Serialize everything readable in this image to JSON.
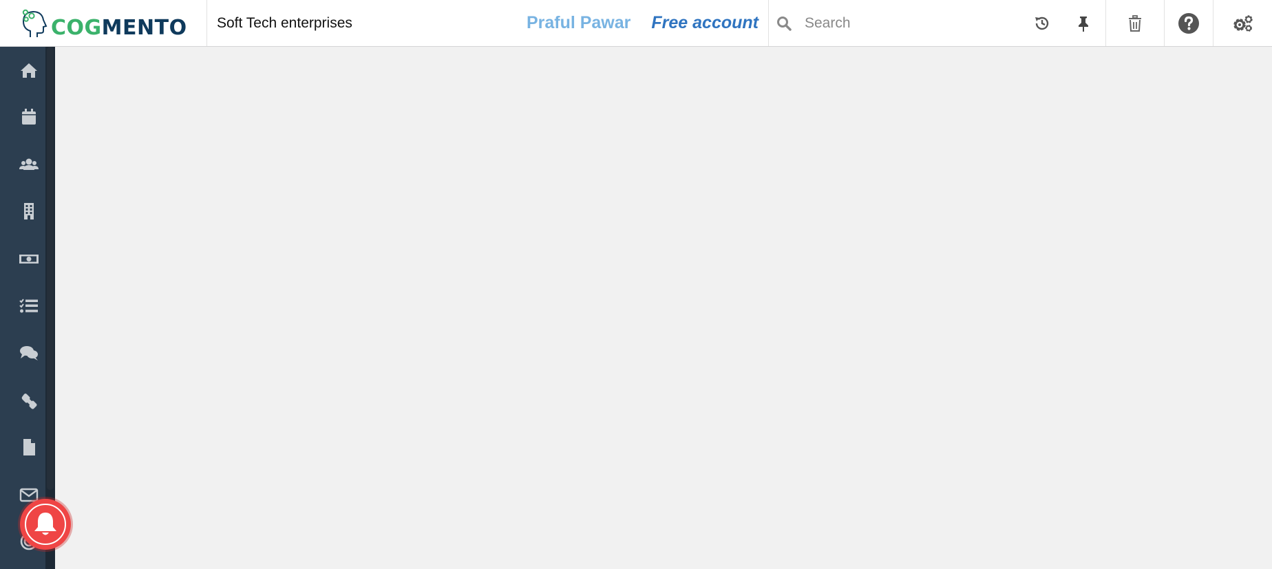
{
  "header": {
    "logo": {
      "cog": "COG",
      "mento": "MENTO"
    },
    "company": "Soft Tech enterprises",
    "user_name": "Praful Pawar",
    "account_type": "Free account",
    "search": {
      "placeholder": "Search",
      "value": ""
    }
  },
  "sidebar": {
    "items": [
      {
        "name": "home",
        "icon": "home-icon"
      },
      {
        "name": "calendar",
        "icon": "calendar-icon"
      },
      {
        "name": "contacts",
        "icon": "users-icon"
      },
      {
        "name": "companies",
        "icon": "building-icon"
      },
      {
        "name": "deals",
        "icon": "money-icon"
      },
      {
        "name": "tasks",
        "icon": "tasks-icon"
      },
      {
        "name": "cases",
        "icon": "comments-icon"
      },
      {
        "name": "calls",
        "icon": "phone-icon"
      },
      {
        "name": "documents",
        "icon": "file-icon"
      },
      {
        "name": "email",
        "icon": "envelope-icon"
      },
      {
        "name": "campaigns",
        "icon": "bullseye-icon"
      }
    ]
  },
  "colors": {
    "sidebar_bg": "#2c3e50",
    "user_name": "#78b3e2",
    "account_type": "#2f74c0",
    "bell": "#ef4545",
    "logo_green": "#3bb26b",
    "logo_navy": "#0f3a5c"
  }
}
